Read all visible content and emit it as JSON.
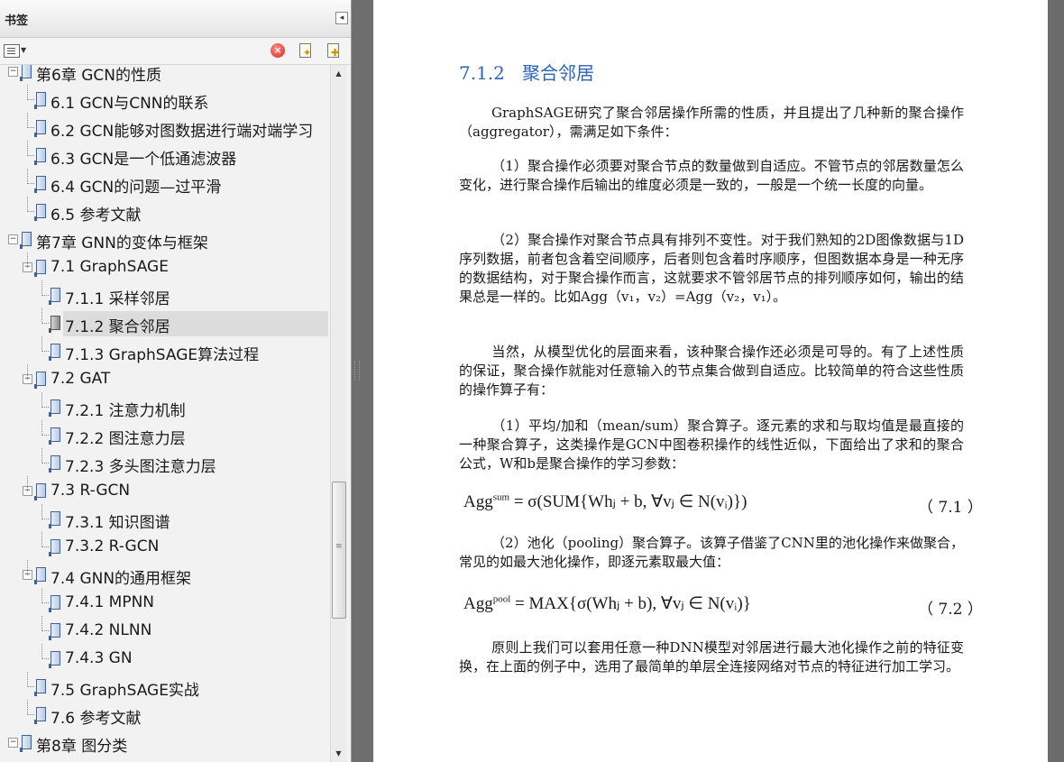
{
  "panel": {
    "title": "书签",
    "collapse_glyph": "◂",
    "toolbar": {
      "options_icon": "bookmark-options-icon",
      "delete_icon": "delete-bookmark-icon",
      "expand_icon": "expand-bookmark-icon",
      "new_icon": "new-bookmark-icon"
    }
  },
  "bookmarks": [
    {
      "label": "第6章 GCN的性质",
      "level": 0,
      "expanded": true
    },
    {
      "label": "6.1 GCN与CNN的联系",
      "level": 1
    },
    {
      "label": "6.2 GCN能够对图数据进行端对端学习",
      "level": 1
    },
    {
      "label": "6.3 GCN是一个低通滤波器",
      "level": 1
    },
    {
      "label": "6.4 GCN的问题—过平滑",
      "level": 1
    },
    {
      "label": "6.5 参考文献",
      "level": 1
    },
    {
      "label": "第7章 GNN的变体与框架",
      "level": 0,
      "expanded": true
    },
    {
      "label": "7.1 GraphSAGE",
      "level": 1,
      "expanded": true
    },
    {
      "label": "7.1.1 采样邻居",
      "level": 2
    },
    {
      "label": "7.1.2 聚合邻居",
      "level": 2,
      "selected": true
    },
    {
      "label": "7.1.3 GraphSAGE算法过程",
      "level": 2
    },
    {
      "label": "7.2 GAT",
      "level": 1,
      "expanded": true
    },
    {
      "label": "7.2.1 注意力机制",
      "level": 2
    },
    {
      "label": "7.2.2 图注意力层",
      "level": 2
    },
    {
      "label": "7.2.3 多头图注意力层",
      "level": 2
    },
    {
      "label": "7.3 R-GCN",
      "level": 1,
      "expanded": true
    },
    {
      "label": "7.3.1 知识图谱",
      "level": 2
    },
    {
      "label": "7.3.2 R-GCN",
      "level": 2
    },
    {
      "label": "7.4 GNN的通用框架",
      "level": 1,
      "expanded": true
    },
    {
      "label": "7.4.1 MPNN",
      "level": 2
    },
    {
      "label": "7.4.2 NLNN",
      "level": 2
    },
    {
      "label": "7.4.3 GN",
      "level": 2
    },
    {
      "label": "7.5 GraphSAGE实战",
      "level": 1
    },
    {
      "label": "7.6 参考文献",
      "level": 1
    },
    {
      "label": "第8章 图分类",
      "level": 0,
      "expanded": true
    }
  ],
  "scrollbar": {
    "up": "▲",
    "down": "▼",
    "grip": "≡"
  },
  "document": {
    "section_number": "7.1.2",
    "section_title": "聚合邻居",
    "p1": "GraphSAGE研究了聚合邻居操作所需的性质，并且提出了几种新的聚合操作（aggregator），需满足如下条件：",
    "p2": "（1）聚合操作必须要对聚合节点的数量做到自适应。不管节点的邻居数量怎么变化，进行聚合操作后输出的维度必须是一致的，一般是一个统一长度的向量。",
    "p3": "（2）聚合操作对聚合节点具有排列不变性。对于我们熟知的2D图像数据与1D序列数据，前者包含着空间顺序，后者则包含着时序顺序，但图数据本身是一种无序的数据结构，对于聚合操作而言，这就要求不管邻居节点的排列顺序如何，输出的结果总是一样的。比如Agg（v₁，v₂）=Agg（v₂，v₁）。",
    "p4": "当然，从模型优化的层面来看，该种聚合操作还必须是可导的。有了上述性质的保证，聚合操作就能对任意输入的节点集合做到自适应。比较简单的符合这些性质的操作算子有：",
    "p5": "（1）平均/加和（mean/sum）聚合算子。逐元素的求和与取均值是最直接的一种聚合算子，这类操作是GCN中图卷积操作的线性近似，下面给出了求和的聚合公式，W和b是聚合操作的学习参数：",
    "eq1_lhs": "Agg",
    "eq1_sup": "sum",
    "eq1_rhs": " = σ(SUM{Whⱼ + b, ∀vⱼ ∈ N(vᵢ)})",
    "eq1_no": "（ 7.1 ）",
    "p6": "（2）池化（pooling）聚合算子。该算子借鉴了CNN里的池化操作来做聚合，常见的如最大池化操作，即逐元素取最大值：",
    "eq2_lhs": "Agg",
    "eq2_sup": "pool",
    "eq2_rhs": " = MAX{σ(Whⱼ + b), ∀vⱼ ∈ N(vᵢ)}",
    "eq2_no": "（ 7.2 ）",
    "p7": "原则上我们可以套用任意一种DNN模型对邻居进行最大池化操作之前的特征变换，在上面的例子中，选用了最简单的单层全连接网络对节点的特征进行加工学习。"
  }
}
